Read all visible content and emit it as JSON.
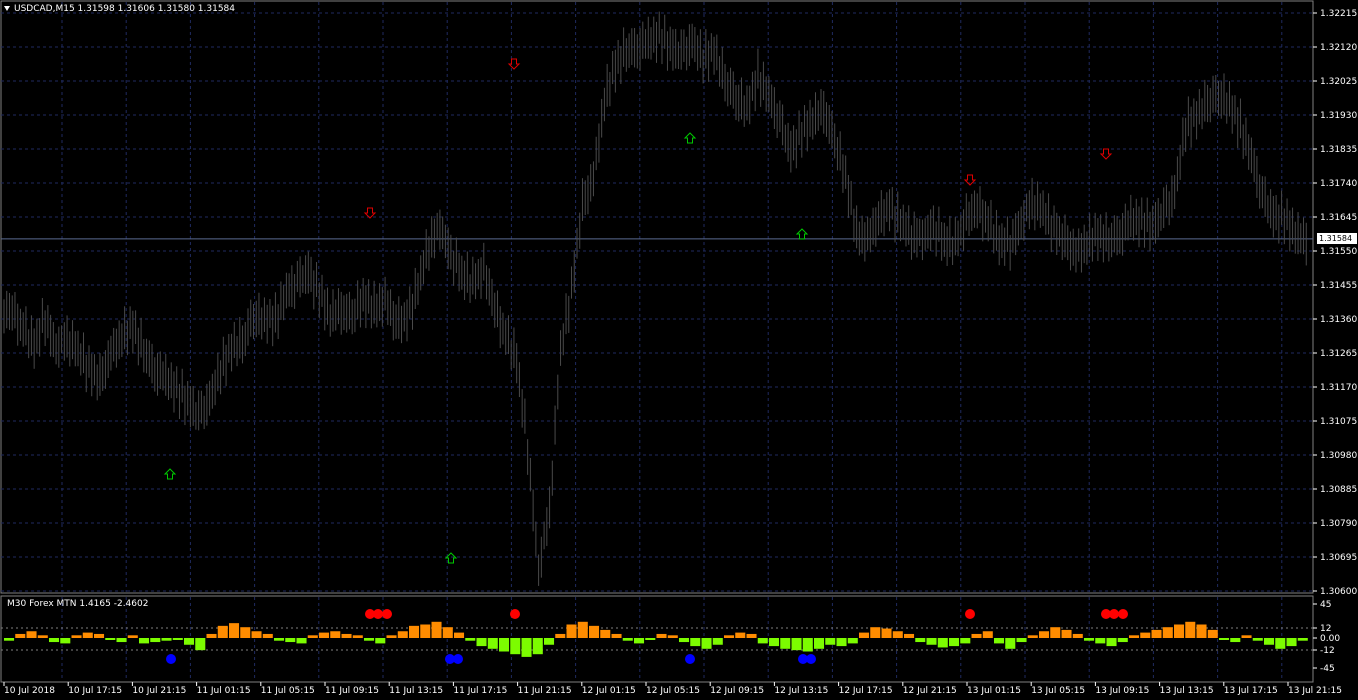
{
  "window": {
    "symbol_info": "USDCAD,M15  1.31598 1.31606 1.31580 1.31584",
    "indicator_info": "M30 Forex MTN  1.4165 -2.4602",
    "current_price": "1.31584"
  },
  "colors": {
    "background": "#000000",
    "grid": "#1f2a60",
    "candle": "#4a4a4a",
    "bar_up": "#ff8c00",
    "bar_down": "#7cfc00",
    "arrow_buy": "#00c800",
    "arrow_sell": "#e00000",
    "dot_top": "#ff0000",
    "dot_bottom": "#0000ff"
  },
  "price_axis": [
    "1.32215",
    "1.32120",
    "1.32025",
    "1.31930",
    "1.31835",
    "1.31740",
    "1.31645",
    "1.31550",
    "1.31455",
    "1.31360",
    "1.31265",
    "1.31170",
    "1.31075",
    "1.30980",
    "1.30885",
    "1.30790",
    "1.30695",
    "1.30600"
  ],
  "indicator_axis": [
    "45",
    "12",
    "0.00",
    "-12",
    "-45"
  ],
  "time_axis": [
    "10 Jul 2018",
    "10 Jul 17:15",
    "10 Jul 21:15",
    "11 Jul 01:15",
    "11 Jul 05:15",
    "11 Jul 09:15",
    "11 Jul 13:15",
    "11 Jul 17:15",
    "11 Jul 21:15",
    "12 Jul 01:15",
    "12 Jul 05:15",
    "12 Jul 09:15",
    "12 Jul 13:15",
    "12 Jul 17:15",
    "12 Jul 21:15",
    "13 Jul 01:15",
    "13 Jul 05:15",
    "13 Jul 09:15",
    "13 Jul 13:15",
    "13 Jul 17:15",
    "13 Jul 21:15"
  ],
  "chart_data": {
    "type": "candlestick",
    "series_close": [
      1.3138,
      1.3133,
      1.3129,
      1.3136,
      1.3128,
      1.3131,
      1.3127,
      1.3122,
      1.3119,
      1.3126,
      1.3131,
      1.3134,
      1.3127,
      1.3122,
      1.312,
      1.3116,
      1.3113,
      1.3109,
      1.3113,
      1.3122,
      1.3128,
      1.313,
      1.3137,
      1.3136,
      1.3136,
      1.3143,
      1.3146,
      1.3149,
      1.3143,
      1.3137,
      1.3139,
      1.3137,
      1.3142,
      1.3139,
      1.3141,
      1.3135,
      1.3136,
      1.3145,
      1.3157,
      1.3162,
      1.3154,
      1.3149,
      1.3146,
      1.315,
      1.3139,
      1.3131,
      1.3125,
      1.31,
      1.3066,
      1.3083,
      1.3127,
      1.3144,
      1.3168,
      1.3175,
      1.3197,
      1.3207,
      1.3211,
      1.3212,
      1.3214,
      1.3215,
      1.3212,
      1.321,
      1.3213,
      1.3209,
      1.3211,
      1.3203,
      1.3198,
      1.3195,
      1.3204,
      1.3198,
      1.3191,
      1.3183,
      1.3188,
      1.3192,
      1.3195,
      1.3186,
      1.3176,
      1.316,
      1.3158,
      1.3164,
      1.3167,
      1.3163,
      1.316,
      1.3159,
      1.3162,
      1.3158,
      1.3157,
      1.3164,
      1.3167,
      1.3163,
      1.3158,
      1.3157,
      1.3163,
      1.3169,
      1.3166,
      1.3161,
      1.3158,
      1.3154,
      1.3157,
      1.316,
      1.3158,
      1.316,
      1.3164,
      1.3163,
      1.3162,
      1.3166,
      1.3171,
      1.319,
      1.3193,
      1.3197,
      1.3199,
      1.3196,
      1.319,
      1.3181,
      1.317,
      1.3165,
      1.3164,
      1.316,
      1.3158
    ],
    "ylim": [
      1.306,
      1.32215
    ],
    "indicator": {
      "name": "M30 Forex MTN",
      "values": [
        -2,
        3,
        5,
        2,
        -3,
        -4,
        2,
        4,
        3,
        -1,
        -3,
        2,
        -4,
        -3,
        -2,
        -1,
        -5,
        -9,
        3,
        9,
        11,
        8,
        5,
        3,
        -2,
        -3,
        -4,
        2,
        4,
        5,
        3,
        2,
        -2,
        -4,
        2,
        5,
        9,
        10,
        12,
        8,
        4,
        -2,
        -6,
        -8,
        -10,
        -12,
        -14,
        -12,
        -5,
        3,
        10,
        12,
        9,
        6,
        3,
        -2,
        -4,
        -1,
        3,
        2,
        -3,
        -6,
        -8,
        -5,
        2,
        4,
        3,
        -4,
        -6,
        -8,
        -9,
        -10,
        -8,
        -5,
        -6,
        -4,
        4,
        8,
        7,
        5,
        3,
        -3,
        -5,
        -7,
        -6,
        -4,
        3,
        5,
        -4,
        -8,
        -3,
        2,
        5,
        8,
        6,
        3,
        -2,
        -4,
        -6,
        -3,
        2,
        4,
        6,
        8,
        10,
        12,
        10,
        6,
        -1,
        -3,
        2,
        -2,
        -5,
        -8,
        -6,
        -2
      ],
      "ylim": [
        -45,
        45
      ]
    },
    "signals": {
      "buy_arrows": [
        "10 Jul 21:15",
        "11 Jul 17:15",
        "12 Jul 05:15",
        "12 Jul 13:15"
      ],
      "sell_arrows": [
        "11 Jul 09:15",
        "11 Jul 21:15",
        "13 Jul 01:15",
        "13 Jul 09:15"
      ]
    }
  }
}
